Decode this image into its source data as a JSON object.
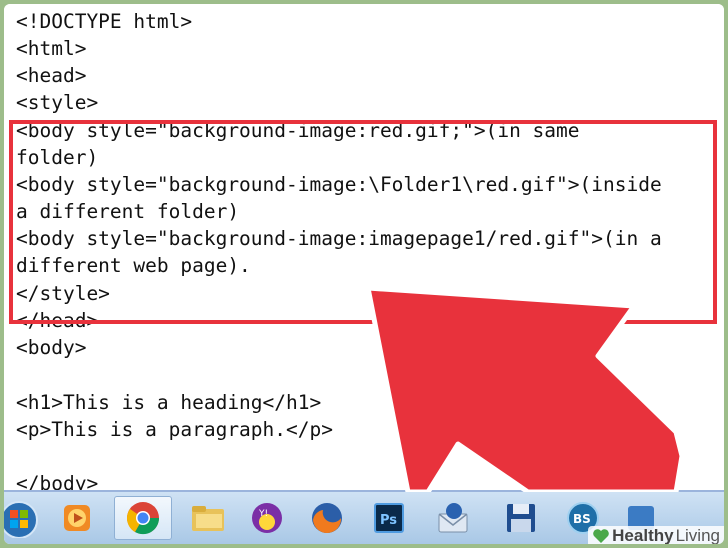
{
  "editor": {
    "lines": [
      "<!DOCTYPE html>",
      "<html>",
      "<head>",
      "<style>",
      "<body style=\"background-image:red.gif;\">(in same",
      "folder)",
      "<body style=\"background-image:\\Folder1\\red.gif\">(inside",
      "a different folder)",
      "<body style=\"background-image:imagepage1/red.gif\">(in a",
      "different web page).",
      "</style>",
      "</head>",
      "<body>",
      "",
      "<h1>This is a heading</h1>",
      "<p>This is a paragraph.</p>",
      "",
      "</body>"
    ]
  },
  "highlight": {
    "color": "#e8323c"
  },
  "taskbar": {
    "icons": [
      {
        "name": "start-orb-icon"
      },
      {
        "name": "media-player-icon"
      },
      {
        "name": "chrome-icon"
      },
      {
        "name": "file-explorer-icon"
      },
      {
        "name": "yahoo-messenger-icon"
      },
      {
        "name": "firefox-icon"
      },
      {
        "name": "photoshop-icon",
        "label": "Ps"
      },
      {
        "name": "thunderbird-icon"
      },
      {
        "name": "save-floppy-icon"
      },
      {
        "name": "bs-player-icon",
        "label": "BS"
      },
      {
        "name": "app-icon"
      }
    ]
  },
  "watermark": {
    "brand_bold": "Healthy",
    "brand_light": "Living"
  }
}
